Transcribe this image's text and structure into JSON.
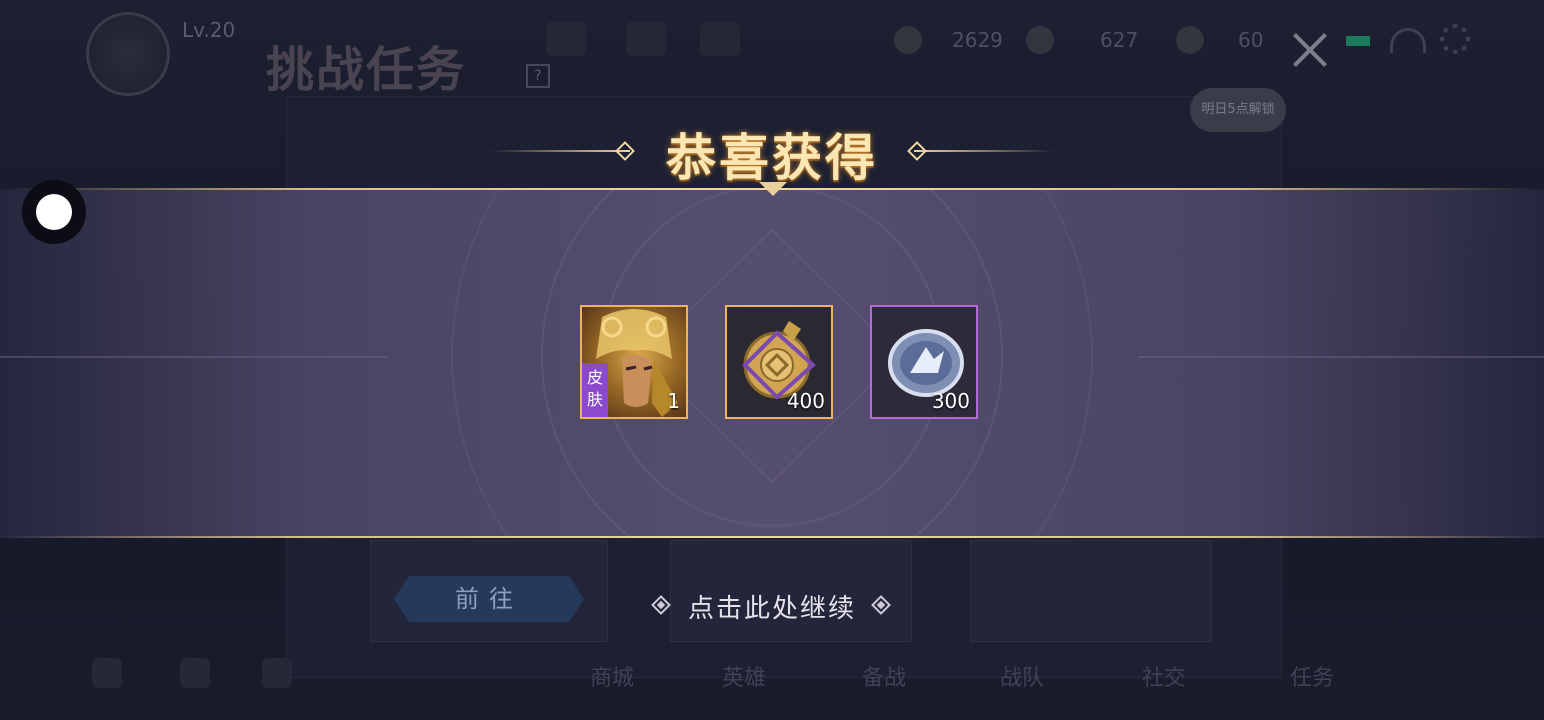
{
  "background": {
    "level": "Lv.20",
    "title": "挑战任务",
    "help_glyph": "?",
    "resources": [
      "2629",
      "627",
      "60"
    ],
    "unlock_bubble": "明日5点解锁",
    "goto_button": "前往",
    "nav": [
      "商城",
      "英雄",
      "备战",
      "战队",
      "社交",
      "任务"
    ]
  },
  "popup": {
    "title": "恭喜获得",
    "continue_label": "点击此处继续",
    "items": [
      {
        "name": "skin",
        "tag": "皮肤",
        "quantity": "1",
        "border_color": "#eab55e"
      },
      {
        "name": "gold-coin-token",
        "quantity": "400",
        "border_color": "#eab55e"
      },
      {
        "name": "silver-coupon-token",
        "quantity": "300",
        "border_color": "#b46ad8"
      }
    ]
  },
  "colors": {
    "band_center": "#564e6e",
    "title_gold": "#fbe7b3",
    "line_gold": "#d8be8c",
    "rare_purple": "#b46ad8"
  }
}
